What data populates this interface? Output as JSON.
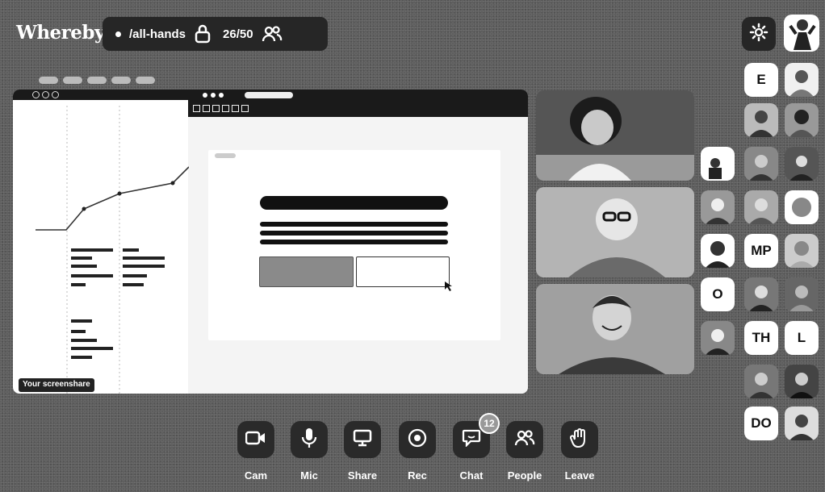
{
  "app": {
    "logo": "Whereby"
  },
  "room": {
    "name": "/all-hands",
    "count": "26/50"
  },
  "screenshare": {
    "label": "Your screenshare"
  },
  "participants": {
    "tiles": [
      {
        "kind": "initials",
        "text": "E"
      },
      {
        "kind": "initials",
        "text": "MP"
      },
      {
        "kind": "initials",
        "text": "O"
      },
      {
        "kind": "initials",
        "text": "TH"
      },
      {
        "kind": "initials",
        "text": "L"
      },
      {
        "kind": "initials",
        "text": "DO"
      }
    ]
  },
  "controls": {
    "cam": "Cam",
    "mic": "Mic",
    "share": "Share",
    "rec": "Rec",
    "chat": "Chat",
    "people": "People",
    "leave": "Leave",
    "chat_badge": "12"
  },
  "icons": [
    "lock-icon",
    "people-icon",
    "gear-icon",
    "camera-icon",
    "mic-icon",
    "share-screen-icon",
    "record-icon",
    "chat-icon",
    "people-icon",
    "wave-hand-icon"
  ]
}
